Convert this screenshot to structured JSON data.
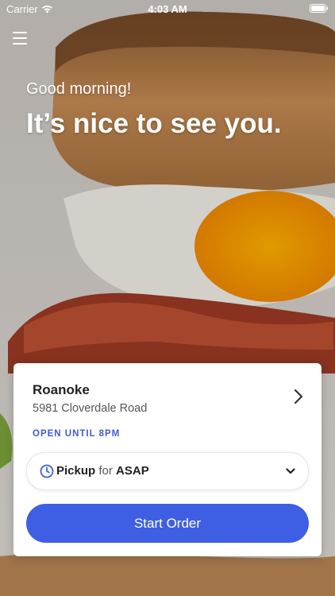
{
  "status_bar": {
    "carrier": "Carrier",
    "time": "4:03 AM"
  },
  "icons": {
    "menu": "hamburger-menu-icon",
    "wifi": "wifi-icon",
    "battery": "battery-icon",
    "store_arrow": "chevron-right-icon",
    "clock": "clock-icon",
    "dropdown": "chevron-down-icon"
  },
  "hero": {
    "greeting": "Good morning!",
    "headline": "It’s nice to see you."
  },
  "store": {
    "name": "Roanoke",
    "address": "5981 Cloverdale Road",
    "hours": "OPEN UNTIL 8PM"
  },
  "order_mode": {
    "method": "Pickup",
    "connector": "for",
    "time": "ASAP"
  },
  "actions": {
    "start_order": "Start Order"
  },
  "colors": {
    "accent": "#3e5fe3",
    "hours_text": "#3d5ad6"
  }
}
